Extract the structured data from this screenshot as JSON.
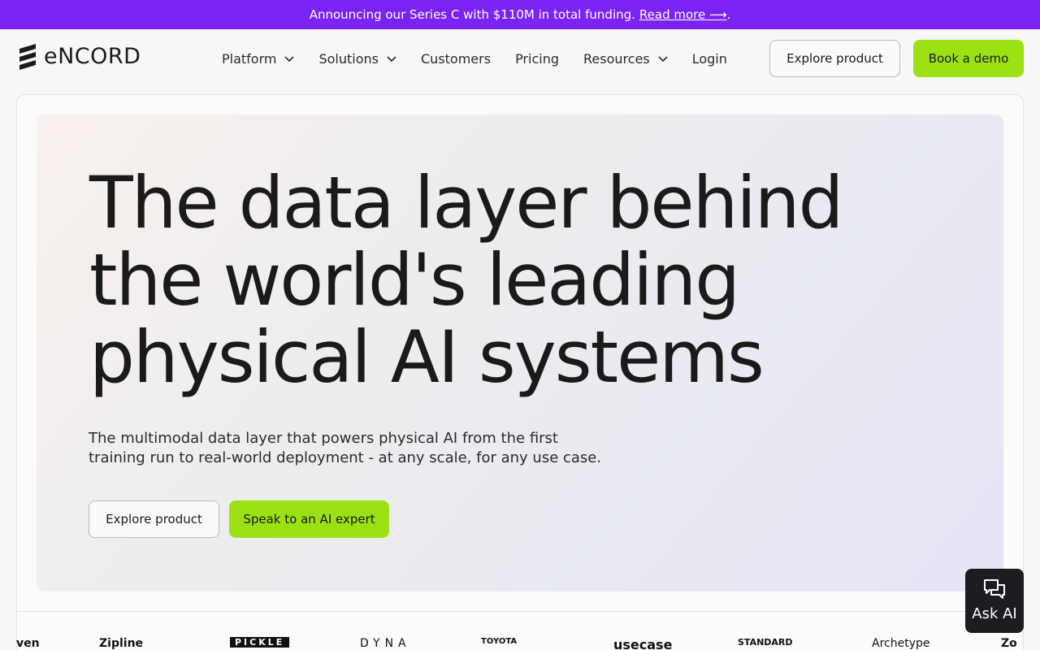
{
  "announcement": {
    "text": "Announcing our Series C with $110M in total funding.",
    "link": "Read more ⟶",
    "tail": "."
  },
  "brand": {
    "name": "eNCORD"
  },
  "nav": {
    "items": [
      {
        "label": "Platform",
        "dropdown": true
      },
      {
        "label": "Solutions",
        "dropdown": true
      },
      {
        "label": "Customers",
        "dropdown": false
      },
      {
        "label": "Pricing",
        "dropdown": false
      },
      {
        "label": "Resources",
        "dropdown": true
      },
      {
        "label": "Login",
        "dropdown": false
      }
    ],
    "explore_label": "Explore product",
    "demo_label": "Book a demo"
  },
  "hero": {
    "title_lines": [
      "The data layer behind",
      "the world's leading",
      "physical AI systems"
    ],
    "subtitle_lines": [
      "The multimodal data layer that powers physical AI from the first",
      "training run to real-world deployment - at any scale, for any use case."
    ],
    "explore_label": "Explore product",
    "expert_label": "Speak to an AI expert"
  },
  "logos": [
    "ven",
    "Zipline",
    "PICKLE",
    "DYNA",
    "TOYOTA",
    "usecase",
    "STANDARD",
    "Archetype",
    "Zo"
  ],
  "ask_ai": {
    "label": "Ask AI"
  },
  "colors": {
    "announcement_bg": "#7a23f2",
    "accent_green": "#9be215",
    "ask_bg": "#1d1d21"
  }
}
